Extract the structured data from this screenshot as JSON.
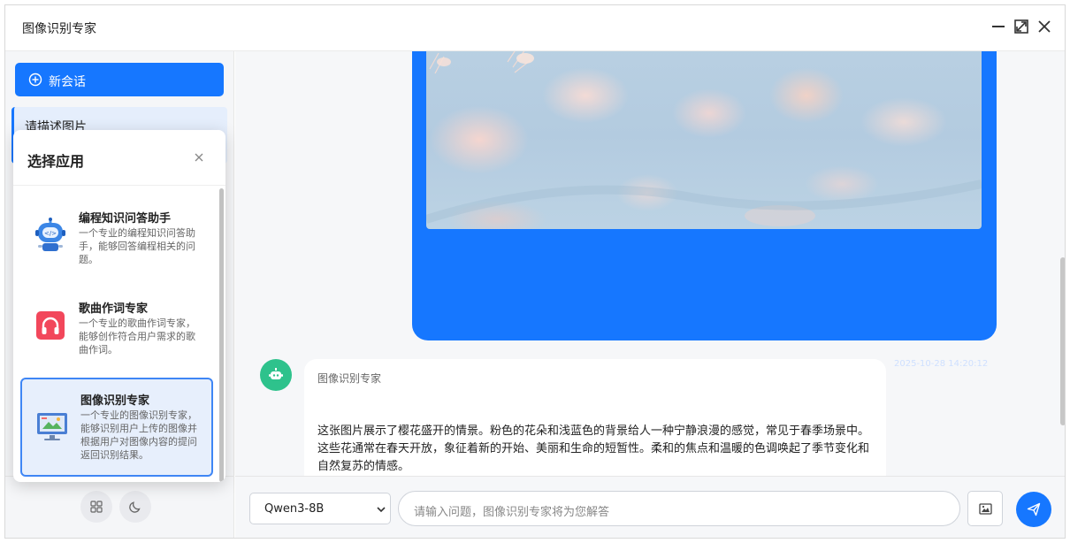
{
  "window": {
    "title": "图像识别专家"
  },
  "sidebar": {
    "new_chat_label": "新会话",
    "sessions": [
      {
        "label": "请描述图片"
      }
    ]
  },
  "app_picker": {
    "title": "选择应用",
    "apps": [
      {
        "name": "编程知识问答助手",
        "description": "一个专业的编程知识问答助手，能够回答编程相关的问题。",
        "icon": "robot-icon",
        "selected": false
      },
      {
        "name": "歌曲作词专家",
        "description": "一个专业的歌曲作词专家，能够创作符合用户需求的歌曲作词。",
        "icon": "headphones-icon",
        "selected": false
      },
      {
        "name": "图像识别专家",
        "description": "一个专业的图像识别专家，能够识别用户上传的图像并根据用户对图像内容的提问返回识别结果。",
        "icon": "image-recognition-icon",
        "selected": true
      }
    ]
  },
  "chat": {
    "user_message": {
      "timestamp": "2025-10-28 14:20:12"
    },
    "bot_message": {
      "sender": "图像识别专家",
      "text": "这张图片展示了樱花盛开的情景。粉色的花朵和浅蓝色的背景给人一种宁静浪漫的感觉，常见于春季场景中。这些花通常在春天开放，象征着新的开始、美丽和生命的短暂性。柔和的焦点和温暖的色调唤起了季节变化和自然复苏的情感。"
    }
  },
  "input": {
    "model": "Qwen3-8B",
    "placeholder": "请输入问题，图像识别专家将为您解答"
  },
  "colors": {
    "accent": "#1677ff",
    "bot_avatar": "#2ec28c"
  }
}
